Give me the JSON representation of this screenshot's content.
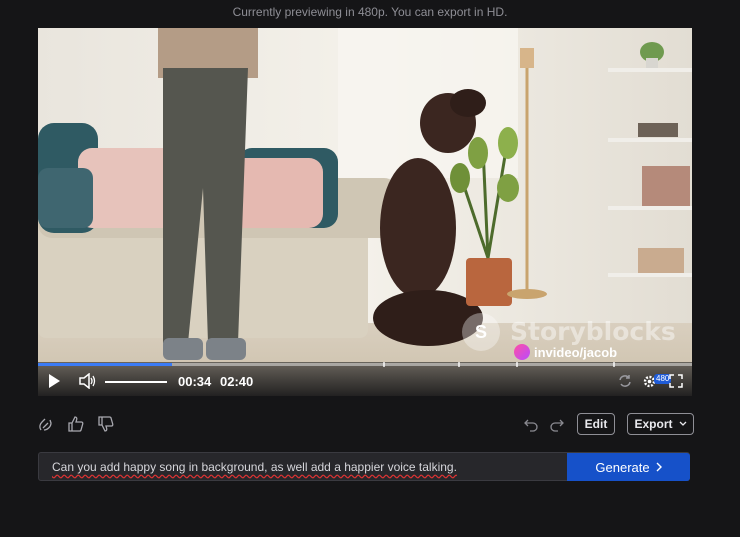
{
  "notice": "Currently previewing in 480p. You can export in HD.",
  "player": {
    "watermark_text": "Storyblocks",
    "credit": "invideo/jacob",
    "progress_fraction": 0.205,
    "volume_fraction": 1.0,
    "current_time": "00:34",
    "duration": "02:40",
    "quality_badge": "480",
    "icons": [
      "play-icon",
      "volume-icon",
      "loop-icon",
      "settings-icon",
      "fullscreen-icon"
    ]
  },
  "actions": {
    "edit_label": "Edit",
    "export_label": "Export",
    "icons": [
      "clap-icon",
      "thumbs-up-icon",
      "thumbs-down-icon",
      "undo-icon",
      "redo-icon"
    ]
  },
  "prompt": {
    "value": "Can you add happy song in background, as well add a happier voice talking.",
    "generate_label": "Generate",
    "generate_icon": "chevron-right-icon"
  },
  "colors": {
    "accent": "#1651c9",
    "progress": "#3a7bf7",
    "background": "#151517"
  }
}
